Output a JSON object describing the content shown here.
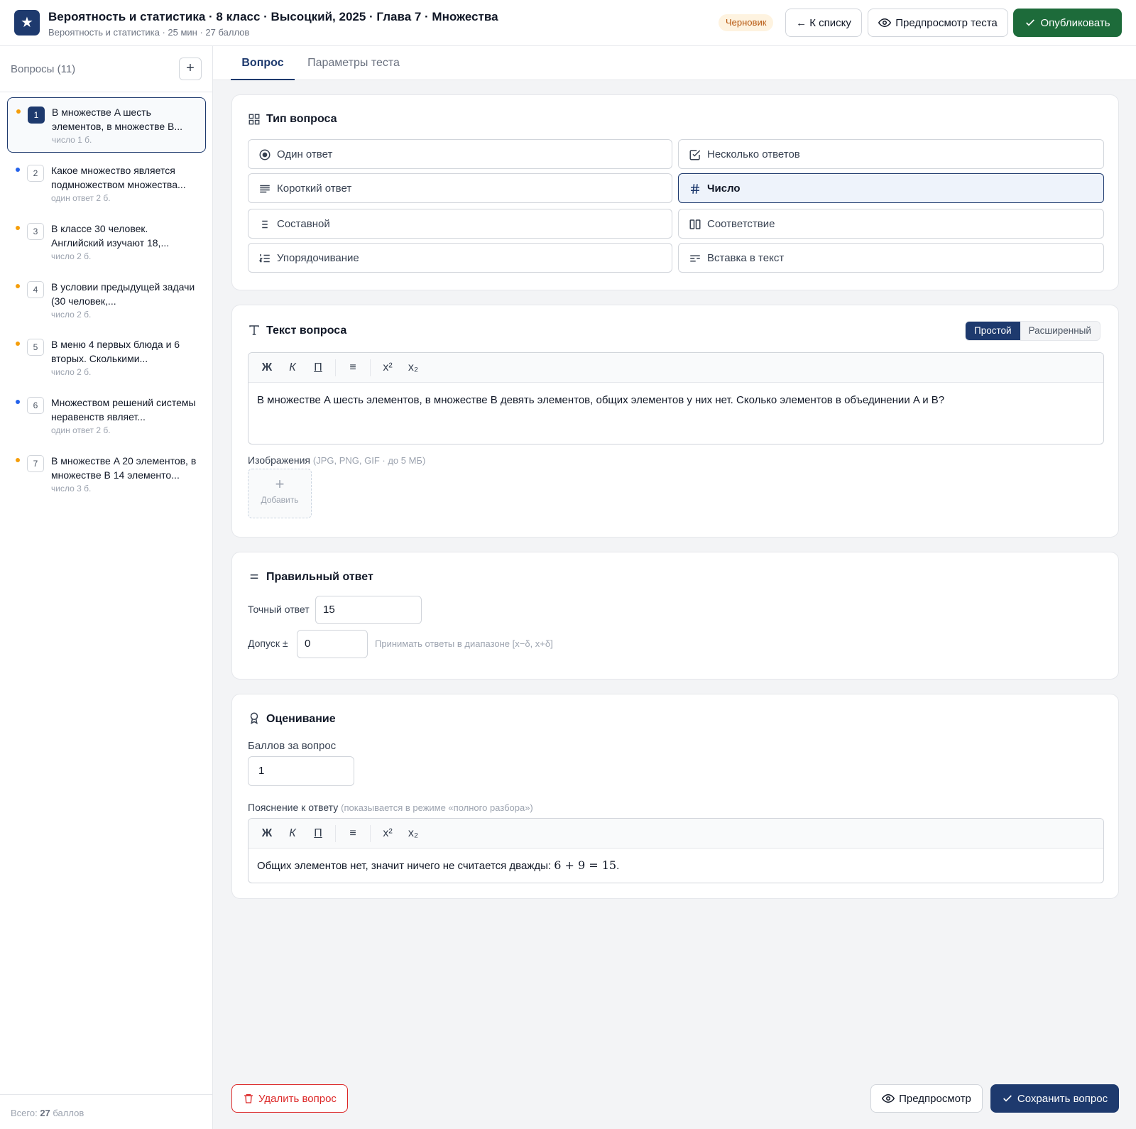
{
  "header": {
    "logo": "★",
    "title": "Вероятность и статистика · 8 класс · Высоцкий, 2025 · Глава 7 · Множества",
    "subtitle": "Вероятность и статистика · 25 мин · 27 баллов",
    "status_badge": "Черновик",
    "back_label": "← К списку",
    "preview_test_label": "Предпросмотр теста",
    "publish_label": "Опубликовать",
    "colors": {
      "brand": "#1e3a6e",
      "publish": "#1d6b3a",
      "draft_bg": "#fef3e0",
      "draft_text": "#b45309"
    }
  },
  "sidebar": {
    "title": "Вопросы (11)",
    "add_label": "+",
    "items": [
      {
        "num": "1",
        "text": "В множестве A шесть элементов, в множестве B...",
        "meta": "число  1 б.",
        "dot": "#f59e0b"
      },
      {
        "num": "2",
        "text": "Какое множество является подмножеством множества...",
        "meta": "один ответ  2 б.",
        "dot": "#2563eb"
      },
      {
        "num": "3",
        "text": "В классе 30 человек. Английский изучают 18,...",
        "meta": "число  2 б.",
        "dot": "#f59e0b"
      },
      {
        "num": "4",
        "text": "В условии предыдущей задачи (30 человек,...",
        "meta": "число  2 б.",
        "dot": "#f59e0b"
      },
      {
        "num": "5",
        "text": "В меню 4 первых блюда и 6 вторых. Сколькими...",
        "meta": "число  2 б.",
        "dot": "#f59e0b"
      },
      {
        "num": "6",
        "text": "Множеством решений системы неравенств являет...",
        "meta": "один ответ  2 б.",
        "dot": "#2563eb"
      },
      {
        "num": "7",
        "text": "В множестве A 20 элементов, в множестве B 14 элементо...",
        "meta": "число  3 б.",
        "dot": "#f59e0b"
      }
    ],
    "footer_prefix": "Всего: ",
    "footer_value": "27",
    "footer_suffix": " баллов"
  },
  "tabs": [
    "Вопрос",
    "Параметры теста"
  ],
  "question_type": {
    "title": "Тип вопроса",
    "options": [
      {
        "label": "Один ответ",
        "icon": "radio-icon"
      },
      {
        "label": "Несколько ответов",
        "icon": "checkbox-icon"
      },
      {
        "label": "Короткий ответ",
        "icon": "short-text-icon"
      },
      {
        "label": "Число",
        "icon": "hash-icon",
        "selected": true
      },
      {
        "label": "Составной",
        "icon": "list-icon"
      },
      {
        "label": "Соответствие",
        "icon": "columns-icon"
      },
      {
        "label": "Упорядочивание",
        "icon": "ordered-list-icon"
      },
      {
        "label": "Вставка в текст",
        "icon": "fill-text-icon"
      }
    ]
  },
  "question_text": {
    "title": "Текст вопроса",
    "mode_simple": "Простой",
    "mode_advanced": "Расширенный",
    "toolbar": {
      "bold": "Ж",
      "italic": "К",
      "underline": "П",
      "list": "≡",
      "sup": "x²",
      "sub": "x₂"
    },
    "content": "В множестве A шесть элементов, в множестве B девять элементов, общих элементов у них нет. Сколько элементов в объединении A и B?",
    "images_label": "Изображения",
    "images_hint": "(JPG, PNG, GIF · до 5 МБ)",
    "add_image_plus": "+",
    "add_image_label": "Добавить"
  },
  "correct_answer": {
    "title": "Правильный ответ",
    "exact_label": "Точный ответ",
    "exact_value": "15",
    "tolerance_label": "Допуск ±",
    "tolerance_value": "0",
    "tolerance_hint": "Принимать ответы в диапазоне [x−δ, x+δ]"
  },
  "grading": {
    "title": "Оценивание",
    "points_label": "Баллов за вопрос",
    "points_value": "1",
    "explanation_label": "Пояснение к ответу",
    "explanation_hint": "(показывается в режиме «полного разбора»)",
    "explanation_text": "Общих элементов нет, значит ничего не считается дважды: ",
    "explanation_math": "6 + 9 = 15",
    "explanation_end": "."
  },
  "footer": {
    "delete_label": "Удалить вопрос",
    "preview_label": "Предпросмотр",
    "save_label": "Сохранить вопрос"
  }
}
